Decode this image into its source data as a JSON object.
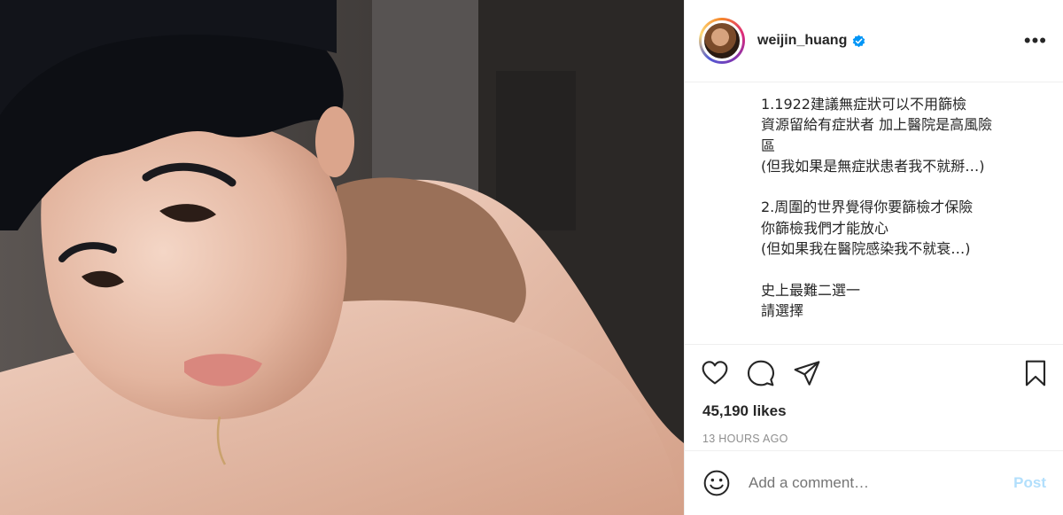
{
  "post": {
    "username": "weijin_huang",
    "verified": true,
    "more_icon": "more-horizontal-icon",
    "caption": "1.1922建議無症狀可以不用篩檢\n資源留給有症狀者 加上醫院是高風險\n區\n(但我如果是無症狀患者我不就掰…)\n\n2.周圍的世界覺得你要篩檢才保險\n你篩檢我們才能放心\n(但如果我在醫院感染我不就衰…)\n\n史上最難二選一\n請選擇",
    "likes": "45,190 likes",
    "time_ago": "13 HOURS AGO"
  },
  "comment": {
    "placeholder": "Add a comment…",
    "post_label": "Post"
  },
  "icons": [
    "heart-icon",
    "comment-icon",
    "share-icon",
    "bookmark-icon",
    "smiley-icon",
    "verified-badge-icon"
  ],
  "colors": {
    "accent": "#0095f6",
    "post_disabled": "#b2dffc",
    "muted": "#8e8e8e",
    "text": "#262626"
  }
}
